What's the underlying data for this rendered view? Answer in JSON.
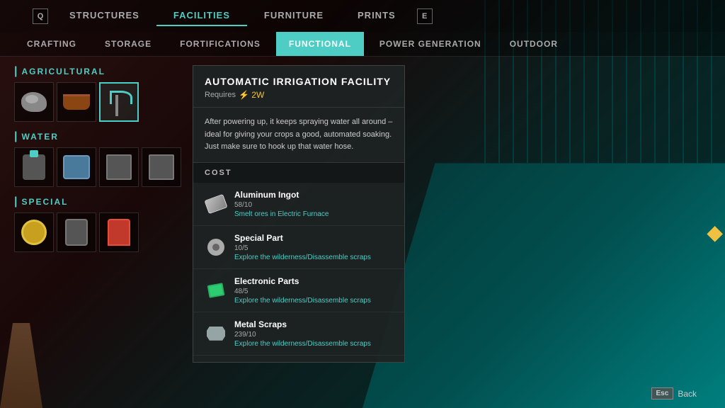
{
  "topNav": {
    "keys": {
      "left": "Q",
      "right": "E"
    },
    "tabs": [
      {
        "label": "STRUCTURES",
        "active": false
      },
      {
        "label": "FACILITIES",
        "active": true
      },
      {
        "label": "FURNITURE",
        "active": false
      },
      {
        "label": "PRINTS",
        "active": false
      }
    ]
  },
  "subNav": {
    "tabs": [
      {
        "label": "CRAFTING",
        "active": false
      },
      {
        "label": "STORAGE",
        "active": false
      },
      {
        "label": "FORTIFICATIONS",
        "active": false
      },
      {
        "label": "FUNCTIONAL",
        "active": true
      },
      {
        "label": "POWER GENERATION",
        "active": false
      },
      {
        "label": "OUTDOOR",
        "active": false
      }
    ]
  },
  "categories": [
    {
      "label": "AGRICULTURAL",
      "items": [
        {
          "icon": "rock",
          "selected": false
        },
        {
          "icon": "trough",
          "selected": false
        },
        {
          "icon": "irrigation",
          "selected": true
        }
      ]
    },
    {
      "label": "WATER",
      "items": [
        {
          "icon": "pump",
          "selected": false
        },
        {
          "icon": "tank",
          "selected": false
        },
        {
          "icon": "container",
          "selected": false
        },
        {
          "icon": "container2",
          "selected": false
        }
      ]
    },
    {
      "label": "SPECIAL",
      "items": [
        {
          "icon": "machine-y",
          "selected": false
        },
        {
          "icon": "machine-g",
          "selected": false
        },
        {
          "icon": "arcade",
          "selected": false
        }
      ]
    }
  ],
  "detail": {
    "title": "AUTOMATIC IRRIGATION FACILITY",
    "requires_label": "Requires",
    "requires_power": "⚡ 2W",
    "description": "After powering up, it keeps spraying water all around – ideal for giving your crops a good, automated soaking. Just make sure to hook up that water hose.",
    "cost_label": "COST",
    "costs": [
      {
        "name": "Aluminum Ingot",
        "amount": "58/10",
        "hint": "Smelt ores in Electric Furnace",
        "icon": "ingot"
      },
      {
        "name": "Special Part",
        "amount": "10/5",
        "hint": "Explore the wilderness/Disassemble scraps",
        "icon": "part"
      },
      {
        "name": "Electronic Parts",
        "amount": "48/5",
        "hint": "Explore the wilderness/Disassemble scraps",
        "icon": "electronic"
      },
      {
        "name": "Metal Scraps",
        "amount": "239/10",
        "hint": "Explore the wilderness/Disassemble scraps",
        "icon": "scrap"
      }
    ]
  },
  "footer": {
    "esc_label": "Esc",
    "back_label": "Back"
  }
}
